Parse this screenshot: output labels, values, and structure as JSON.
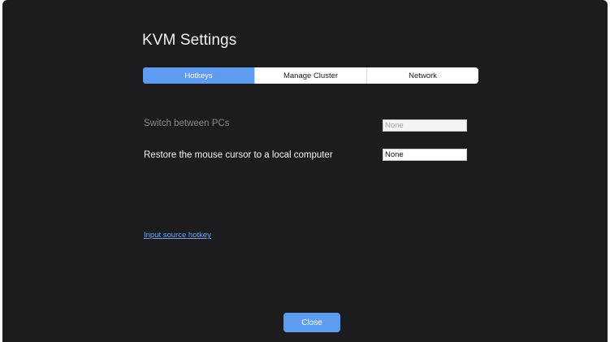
{
  "window": {
    "title": "KVM Settings"
  },
  "tabs": [
    {
      "label": "Hotkeys",
      "active": true
    },
    {
      "label": "Manage Cluster",
      "active": false
    },
    {
      "label": "Network",
      "active": false
    }
  ],
  "hotkeys": {
    "switch_pcs": {
      "label": "Switch between PCs",
      "value": "None",
      "enabled": false
    },
    "restore_cursor": {
      "label": "Restore the mouse cursor to a local computer",
      "value": "None",
      "enabled": true
    }
  },
  "links": {
    "input_source": "Input source hotkey"
  },
  "buttons": {
    "close": "Close"
  },
  "colors": {
    "accent": "#5d9cf0",
    "background": "#1c1c1e",
    "link": "#6aa6f5"
  }
}
